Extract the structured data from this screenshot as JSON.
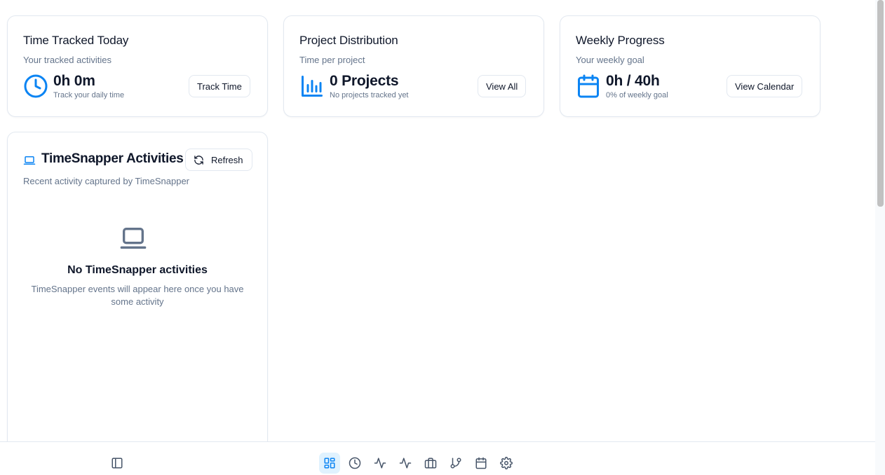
{
  "cards": {
    "time_today": {
      "title": "Time Tracked Today",
      "subtitle": "Your tracked activities",
      "value": "0h 0m",
      "caption": "Track your daily time",
      "button": "Track Time",
      "icon": "clock-icon"
    },
    "projects": {
      "title": "Project Distribution",
      "subtitle": "Time per project",
      "value": "0 Projects",
      "caption": "No projects tracked yet",
      "button": "View All",
      "icon": "bar-chart-icon"
    },
    "weekly": {
      "title": "Weekly Progress",
      "subtitle": "Your weekly goal",
      "value": "0h / 40h",
      "caption": "0% of weekly goal",
      "button": "View Calendar",
      "icon": "calendar-icon"
    }
  },
  "activities": {
    "title": "TimeSnapper Activities",
    "subtitle": "Recent activity captured by TimeSnapper",
    "refresh_label": "Refresh",
    "empty_title": "No TimeSnapper activities",
    "empty_desc": "TimeSnapper events will appear here once you have some activity",
    "icon": "laptop-icon"
  },
  "bottom_nav": {
    "sidebar_toggle_icon": "sidebar-toggle-icon",
    "items": [
      {
        "icon": "dashboard-icon",
        "active": true
      },
      {
        "icon": "clock-icon",
        "active": false
      },
      {
        "icon": "activity-icon",
        "active": false
      },
      {
        "icon": "activity-icon",
        "active": false
      },
      {
        "icon": "briefcase-icon",
        "active": false
      },
      {
        "icon": "git-branch-icon",
        "active": false
      },
      {
        "icon": "calendar-icon",
        "active": false
      },
      {
        "icon": "settings-icon",
        "active": false
      }
    ]
  },
  "colors": {
    "accent": "#0b84f3",
    "text": "#0f172a",
    "muted": "#64748b",
    "border": "#e2e8f0",
    "nav_icon": "#475569",
    "active_bg": "#e0f2fe"
  }
}
